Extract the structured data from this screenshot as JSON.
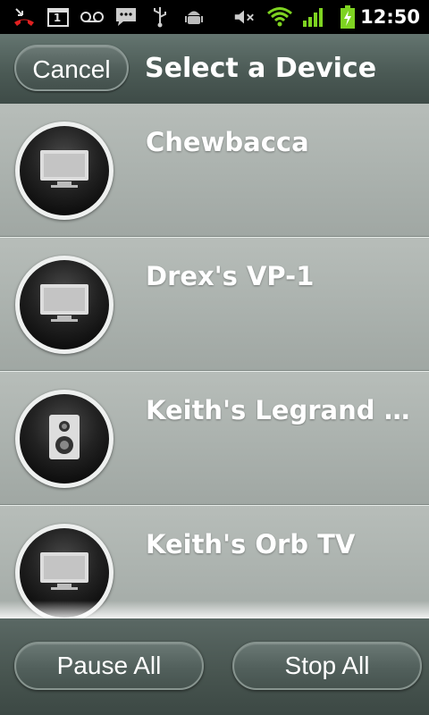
{
  "status_bar": {
    "time": "12:50",
    "icons": [
      "missed-call-icon",
      "calendar-icon",
      "voicemail-icon",
      "sms-icon",
      "usb-icon",
      "android-debug-icon",
      "mute-icon",
      "wifi-icon",
      "signal-icon",
      "battery-charging-icon"
    ],
    "calendar_day": "1"
  },
  "header": {
    "cancel_label": "Cancel",
    "title": "Select a Device"
  },
  "devices": [
    {
      "name": "Chewbacca",
      "icon": "tv-icon"
    },
    {
      "name": "Drex's VP-1",
      "icon": "tv-icon"
    },
    {
      "name": "Keith's Legrand Dev...",
      "icon": "speaker-icon"
    },
    {
      "name": "Keith's Orb TV",
      "icon": "tv-icon"
    }
  ],
  "footer": {
    "pause_label": "Pause All",
    "stop_label": "Stop All"
  },
  "colors": {
    "wifi": "#7ed321",
    "signal": "#7ed321",
    "battery": "#7ed321",
    "missed_call": "#e02020"
  }
}
